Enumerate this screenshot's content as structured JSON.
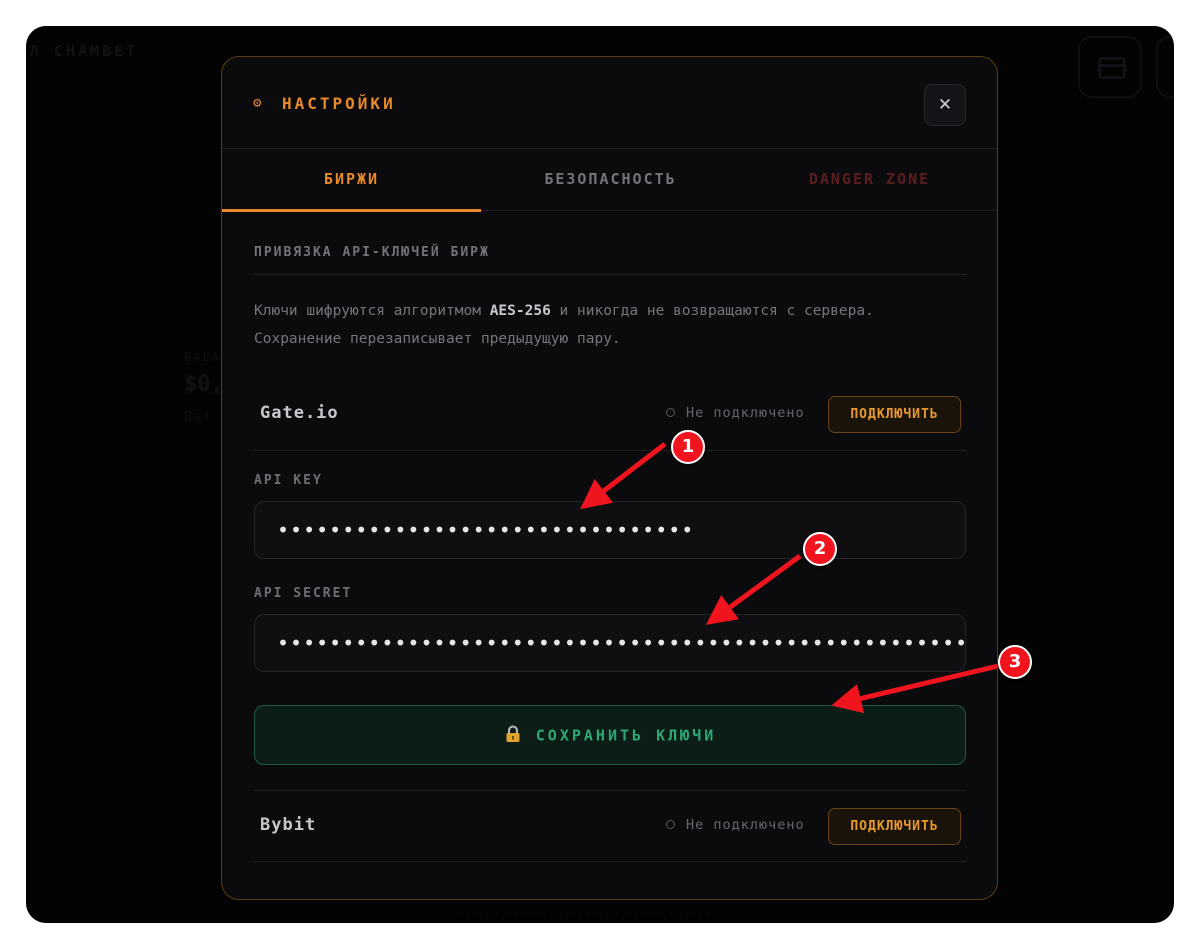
{
  "background": {
    "brand": "Λ CHAMBET",
    "label": "BALANCE",
    "value": "$0,",
    "sub": "Bal",
    "right": "...",
    "footer": "............................"
  },
  "modal": {
    "title": "НАСТРОЙКИ",
    "gear_icon": "⚙",
    "close_label": "✕"
  },
  "tabs": [
    {
      "label": "БИРЖИ",
      "active": true
    },
    {
      "label": "БЕЗОПАСНОСТЬ",
      "active": false
    },
    {
      "label": "DANGER ZONE",
      "active": false
    }
  ],
  "section": {
    "title": "ПРИВЯЗКА API-КЛЮЧЕЙ БИРЖ",
    "desc_before": "Ключи шифруются алгоритмом ",
    "desc_bold": "AES-256",
    "desc_after": " и никогда не возвращаются с сервера. Сохранение перезаписывает предыдущую пару."
  },
  "exchanges": [
    {
      "name": "Gate.io",
      "status": "Не подключено",
      "button": "ПОДКЛЮЧИТЬ"
    },
    {
      "name": "Bybit",
      "status": "Не подключено",
      "button": "ПОДКЛЮЧИТЬ"
    }
  ],
  "form": {
    "api_key_label": "API KEY",
    "api_key_value": "••••••••••••••••••••••••••••••••",
    "api_secret_label": "API SECRET",
    "api_secret_value": "••••••••••••••••••••••••••••••••••••••••••••••••••••••••••••••••",
    "save_label": "СОХРАНИТЬ КЛЮЧИ",
    "save_icon": "lock-icon"
  },
  "annotations": [
    {
      "number": "1"
    },
    {
      "number": "2"
    },
    {
      "number": "3"
    }
  ],
  "colors": {
    "accent": "#e8892a",
    "danger": "#5c1d1d",
    "save_green": "#2ea877",
    "annotation_red": "#f0141e"
  }
}
